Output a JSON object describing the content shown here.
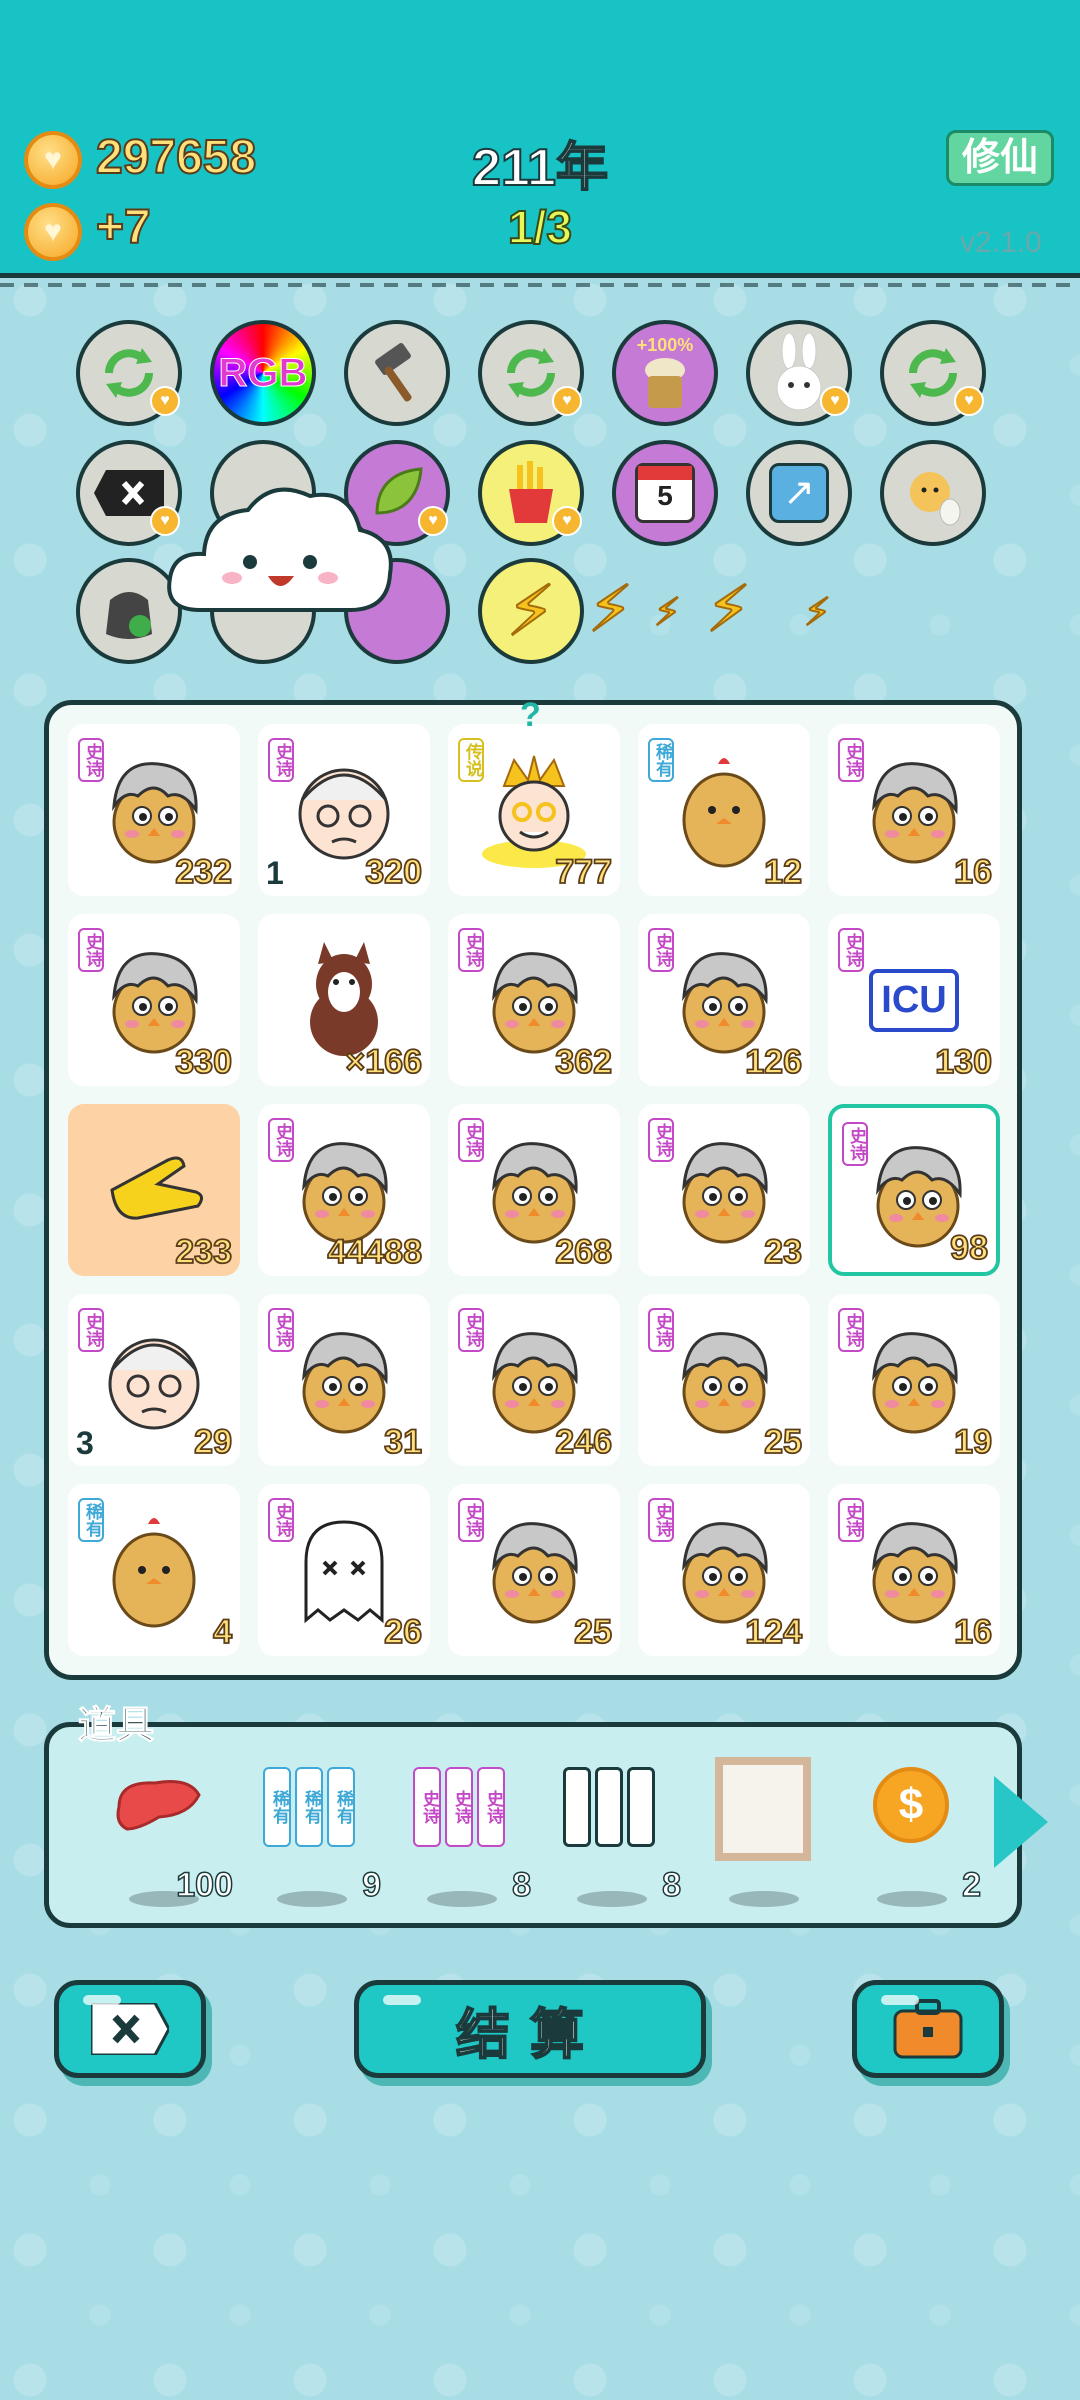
{
  "header": {
    "coins": "297658",
    "income": "+7",
    "year": "211年",
    "page": "1/3",
    "cultivate_label": "修仙",
    "version": "v2.1.0"
  },
  "abilities": {
    "row1": [
      "refresh-icon",
      "rgb-icon",
      "hammer-icon",
      "refresh-icon",
      "jar-icon",
      "rabbit-icon",
      "refresh-icon"
    ],
    "rgb_label": "RGB",
    "jar_label": "+100%",
    "calendar_day": "5"
  },
  "board": {
    "cells": [
      {
        "tag": "史诗",
        "count": "232"
      },
      {
        "tag": "史诗",
        "level": "1",
        "count": "320"
      },
      {
        "tag": "传说",
        "count": "777",
        "marker": "?"
      },
      {
        "tag": "稀有",
        "count": "12"
      },
      {
        "tag": "史诗",
        "count": "16"
      },
      {
        "tag": "史诗",
        "count": "330"
      },
      {
        "tag": "",
        "count": "×166"
      },
      {
        "tag": "史诗",
        "count": "362"
      },
      {
        "tag": "史诗",
        "count": "126"
      },
      {
        "tag": "史诗",
        "count": "130",
        "icu": "ICU"
      },
      {
        "tag": "",
        "count": "233"
      },
      {
        "tag": "史诗",
        "count": "44488"
      },
      {
        "tag": "史诗",
        "count": "268"
      },
      {
        "tag": "史诗",
        "count": "23"
      },
      {
        "tag": "史诗",
        "count": "98"
      },
      {
        "tag": "史诗",
        "level": "3",
        "count": "29"
      },
      {
        "tag": "史诗",
        "count": "31"
      },
      {
        "tag": "史诗",
        "count": "246"
      },
      {
        "tag": "史诗",
        "count": "25"
      },
      {
        "tag": "史诗",
        "count": "19"
      },
      {
        "tag": "稀有",
        "count": "4"
      },
      {
        "tag": "史诗",
        "count": "26"
      },
      {
        "tag": "史诗",
        "count": "25"
      },
      {
        "tag": "史诗",
        "count": "124"
      },
      {
        "tag": "史诗",
        "count": "16"
      }
    ]
  },
  "items": {
    "title": "道具",
    "list": [
      {
        "icon": "liver-icon",
        "count": "100"
      },
      {
        "icon": "rare-cards-icon",
        "count": "9",
        "label": "稀有"
      },
      {
        "icon": "epic-cards-icon",
        "count": "8",
        "label": "史诗"
      },
      {
        "icon": "blank-cards-icon",
        "count": "8"
      },
      {
        "icon": "frame-icon",
        "count": ""
      },
      {
        "icon": "coin-icon",
        "count": "2"
      }
    ]
  },
  "footer": {
    "settle_label": "结算"
  }
}
